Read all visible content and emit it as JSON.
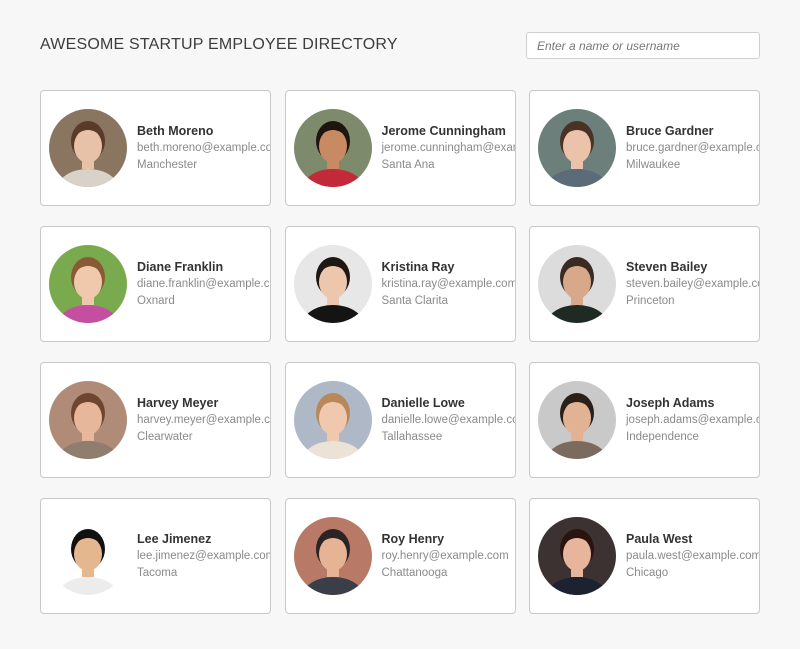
{
  "header": {
    "title": "AWESOME STARTUP EMPLOYEE DIRECTORY",
    "search_placeholder": "Enter a name or username"
  },
  "employees": [
    {
      "name": "Beth Moreno",
      "email": "beth.moreno@example.com",
      "city": "Manchester",
      "colors": {
        "bg": "#8a7560",
        "skin": "#e8c2a8",
        "hair": "#5a3a28",
        "shirt": "#d9d2c8"
      }
    },
    {
      "name": "Jerome Cunningham",
      "email": "jerome.cunningham@example.com",
      "city": "Santa Ana",
      "colors": {
        "bg": "#7d8a6c",
        "skin": "#c88a62",
        "hair": "#1e1510",
        "shirt": "#c22a3a"
      }
    },
    {
      "name": "Bruce Gardner",
      "email": "bruce.gardner@example.com",
      "city": "Milwaukee",
      "colors": {
        "bg": "#6d7f7a",
        "skin": "#eac3aa",
        "hair": "#4a3324",
        "shirt": "#5b6b78"
      }
    },
    {
      "name": "Diane Franklin",
      "email": "diane.franklin@example.com",
      "city": "Oxnard",
      "colors": {
        "bg": "#7aaa4e",
        "skin": "#f0c9ad",
        "hair": "#8a5a35",
        "shirt": "#c44ea0"
      }
    },
    {
      "name": "Kristina Ray",
      "email": "kristina.ray@example.com",
      "city": "Santa Clarita",
      "colors": {
        "bg": "#e7e7e7",
        "skin": "#ecc7ae",
        "hair": "#1f1714",
        "shirt": "#141414"
      }
    },
    {
      "name": "Steven Bailey",
      "email": "steven.bailey@example.com",
      "city": "Princeton",
      "colors": {
        "bg": "#dcdcdc",
        "skin": "#d7a98a",
        "hair": "#3a2a22",
        "shirt": "#1e2a22"
      }
    },
    {
      "name": "Harvey Meyer",
      "email": "harvey.meyer@example.com",
      "city": "Clearwater",
      "colors": {
        "bg": "#b08c78",
        "skin": "#e6b79a",
        "hair": "#6e4630",
        "shirt": "#8f7e6e"
      }
    },
    {
      "name": "Danielle Lowe",
      "email": "danielle.lowe@example.com",
      "city": "Tallahassee",
      "colors": {
        "bg": "#aeb8c6",
        "skin": "#f0c8ad",
        "hair": "#b8885a",
        "shirt": "#ece2d6"
      }
    },
    {
      "name": "Joseph Adams",
      "email": "joseph.adams@example.com",
      "city": "Independence",
      "colors": {
        "bg": "#c9c9c9",
        "skin": "#e1b393",
        "hair": "#2a201a",
        "shirt": "#7b6a5e"
      }
    },
    {
      "name": "Lee Jimenez",
      "email": "lee.jimenez@example.com",
      "city": "Tacoma",
      "colors": {
        "bg": "#ffffff",
        "skin": "#e4b78e",
        "hair": "#111111",
        "shirt": "#ececec"
      }
    },
    {
      "name": "Roy Henry",
      "email": "roy.henry@example.com",
      "city": "Chattanooga",
      "colors": {
        "bg": "#b87a66",
        "skin": "#e6b395",
        "hair": "#2a2424",
        "shirt": "#3a3e48"
      }
    },
    {
      "name": "Paula West",
      "email": "paula.west@example.com",
      "city": "Chicago",
      "colors": {
        "bg": "#3c3232",
        "skin": "#e7b49c",
        "hair": "#2a1410",
        "shirt": "#1d2230"
      }
    }
  ]
}
